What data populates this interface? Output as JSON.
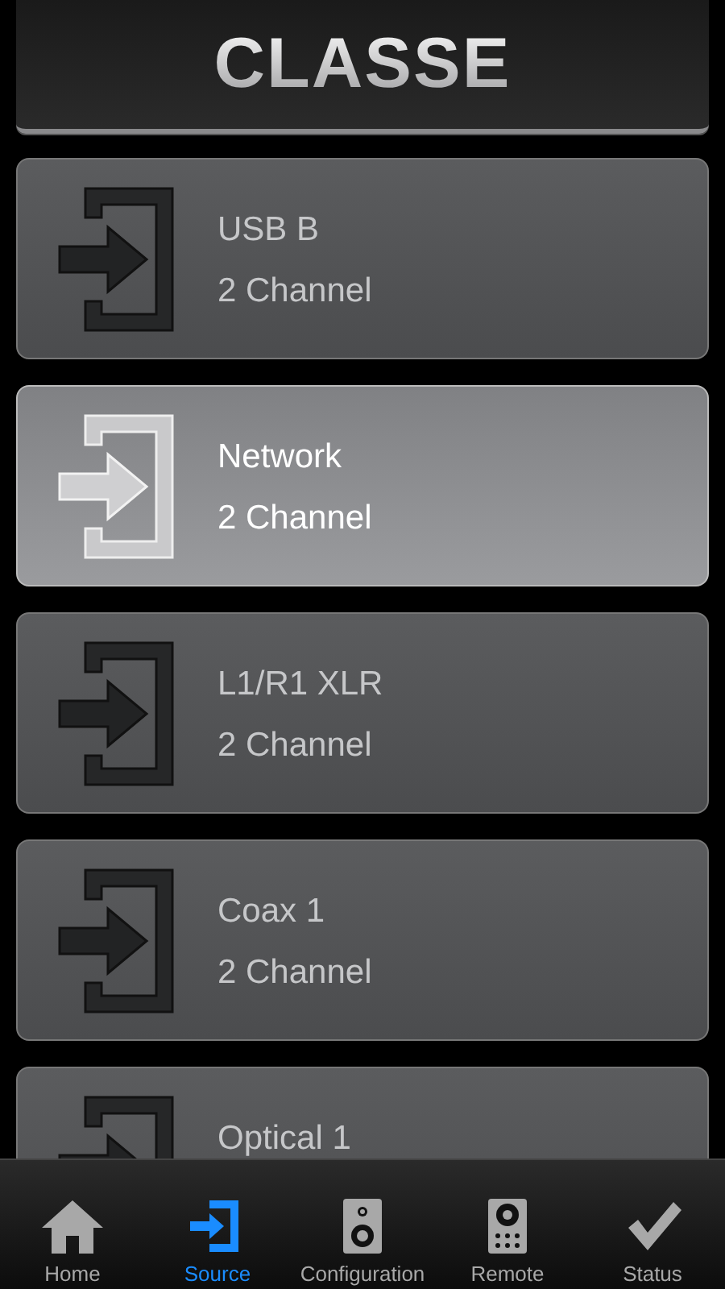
{
  "header": {
    "logo": "CLASSE"
  },
  "sources": [
    {
      "name": "USB B",
      "format": "2 Channel",
      "selected": false
    },
    {
      "name": "Network",
      "format": "2 Channel",
      "selected": true
    },
    {
      "name": "L1/R1 XLR",
      "format": "2 Channel",
      "selected": false
    },
    {
      "name": "Coax 1",
      "format": "2 Channel",
      "selected": false
    },
    {
      "name": "Optical 1",
      "selected": false
    }
  ],
  "tabs": [
    {
      "label": "Home",
      "kind": "home",
      "selected": false
    },
    {
      "label": "Source",
      "kind": "source",
      "selected": true
    },
    {
      "label": "Configuration",
      "kind": "speaker",
      "selected": false
    },
    {
      "label": "Remote",
      "kind": "remote",
      "selected": false
    },
    {
      "label": "Status",
      "kind": "check",
      "selected": false
    }
  ]
}
